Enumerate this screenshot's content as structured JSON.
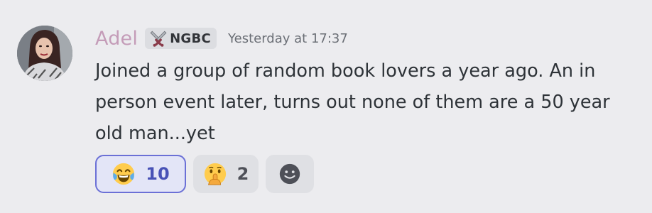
{
  "message": {
    "author": "Adel",
    "tag": {
      "icon": "crossed-swords-icon",
      "label": "NGBC"
    },
    "timestamp": "Yesterday at 17:37",
    "text": "Joined a group of random book lovers a year ago. An in person event later, turns out none of them are a 50 year old man...yet",
    "reactions": [
      {
        "emoji": "face-with-tears-of-joy-emoji",
        "count": "10",
        "selected": true
      },
      {
        "emoji": "shushing-face-emoji",
        "count": "2",
        "selected": false
      }
    ],
    "add_reaction_icon": "add-reaction-icon"
  },
  "colors": {
    "background": "#ececef",
    "author": "#c49cb8",
    "active_reaction_border": "#6b70d6",
    "active_reaction_count": "#4852b6"
  }
}
